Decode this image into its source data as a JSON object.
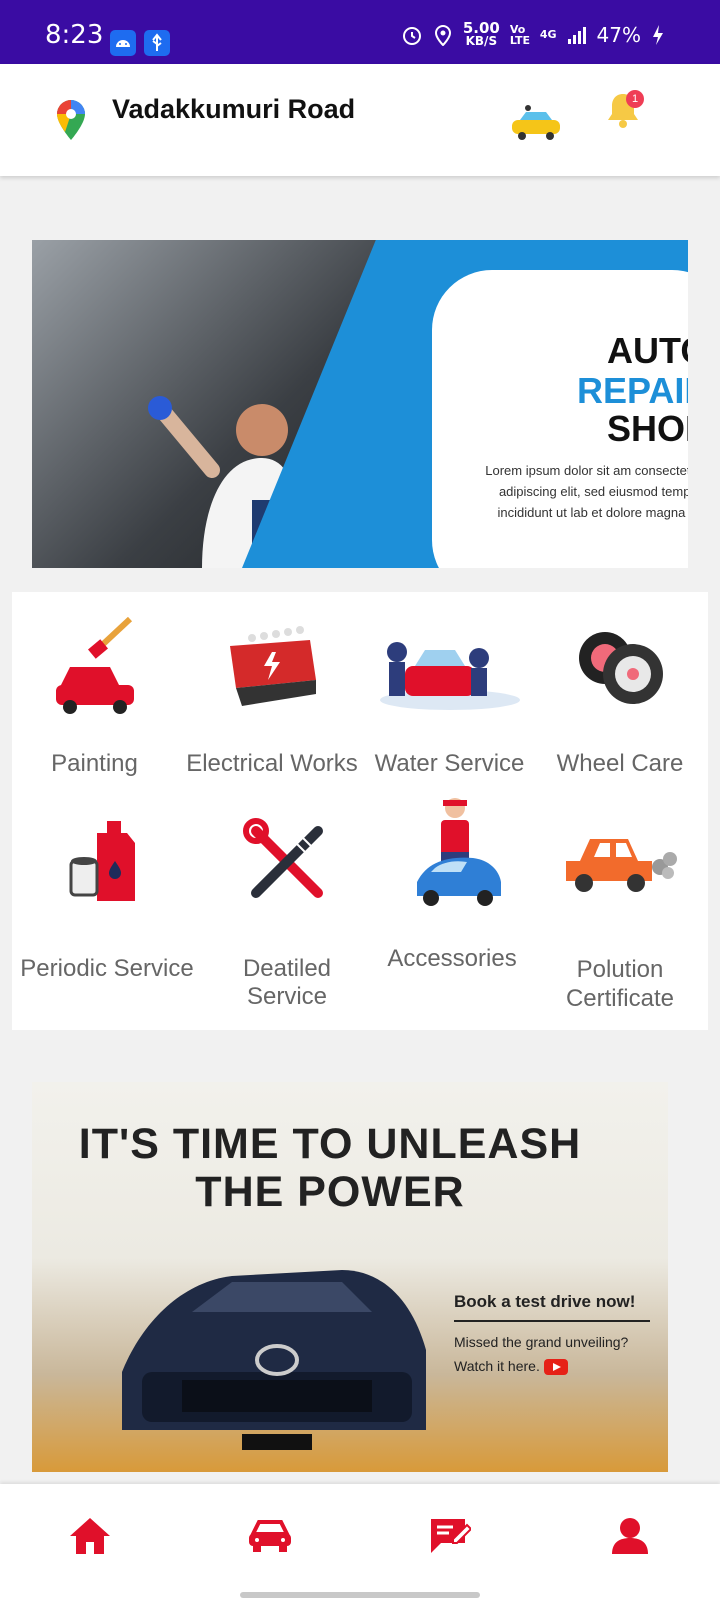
{
  "status_bar": {
    "time": "8:23",
    "speed_value": "5.00",
    "speed_unit": "KB/S",
    "volte": "Vo LTE",
    "network": "4G",
    "battery": "47%"
  },
  "header": {
    "location": "Vadakkumuri Road",
    "notification_count": "1"
  },
  "banner_top": {
    "title_line1": "AUTO",
    "title_line2": "REPAIR",
    "title_line3": "SHOP",
    "body": "Lorem ipsum dolor sit am consectetur adipiscing elit, sed eiusmod tempor incididunt ut lab et dolore magna ali"
  },
  "services": [
    {
      "label": "Painting",
      "icon": "painting-car-icon"
    },
    {
      "label": "Electrical Works",
      "icon": "car-battery-icon"
    },
    {
      "label": "Water Service",
      "icon": "car-wash-icon"
    },
    {
      "label": "Wheel Care",
      "icon": "wheel-tire-icon"
    },
    {
      "label": "Periodic Service",
      "icon": "oil-filter-icon"
    },
    {
      "label": "Deatiled Service",
      "icon": "wrench-shock-icon"
    },
    {
      "label": "Accessories",
      "icon": "mechanic-car-icon"
    },
    {
      "label": "Polution Certificate",
      "icon": "car-exhaust-icon"
    }
  ],
  "banner_bottom": {
    "headline": "IT'S TIME TO UNLEASH THE POWER",
    "cta": "Book a test drive now!",
    "subtext": "Missed the grand unveiling? Watch it here."
  },
  "bottom_nav": [
    {
      "name": "home",
      "icon": "home-icon",
      "active": true
    },
    {
      "name": "vehicle",
      "icon": "car-icon",
      "active": false
    },
    {
      "name": "bookings",
      "icon": "edit-note-icon",
      "active": false
    },
    {
      "name": "profile",
      "icon": "person-icon",
      "active": false
    }
  ],
  "colors": {
    "status_bar": "#3a0ca3",
    "accent_red": "#e0102a",
    "banner_blue": "#1d8fd8",
    "bell": "#f6c945"
  }
}
